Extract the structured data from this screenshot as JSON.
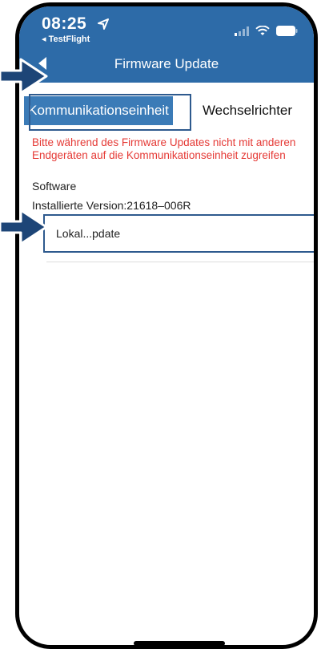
{
  "status_bar": {
    "time": "08:25",
    "back_app": "◂ TestFlight"
  },
  "nav": {
    "title": "Firmware Update"
  },
  "tabs": [
    {
      "label": "Kommunikationseinheit",
      "selected": true
    },
    {
      "label": "Wechselrichter",
      "selected": false
    }
  ],
  "warning": {
    "line1": "Bitte während des Firmware Updates nicht mit anderen",
    "line2": "Endgeräten auf die Kommunikationseinheit zugreifen"
  },
  "section": {
    "software_label": "Software",
    "installed_version": "Installierte Version:21618–006R",
    "update_option": "Lokal...pdate"
  },
  "colors": {
    "nav_bar": "#2d6ba8",
    "tab_active": "#3b7bb7",
    "warning_text": "#e53935",
    "highlight": "#2e5a8e"
  }
}
